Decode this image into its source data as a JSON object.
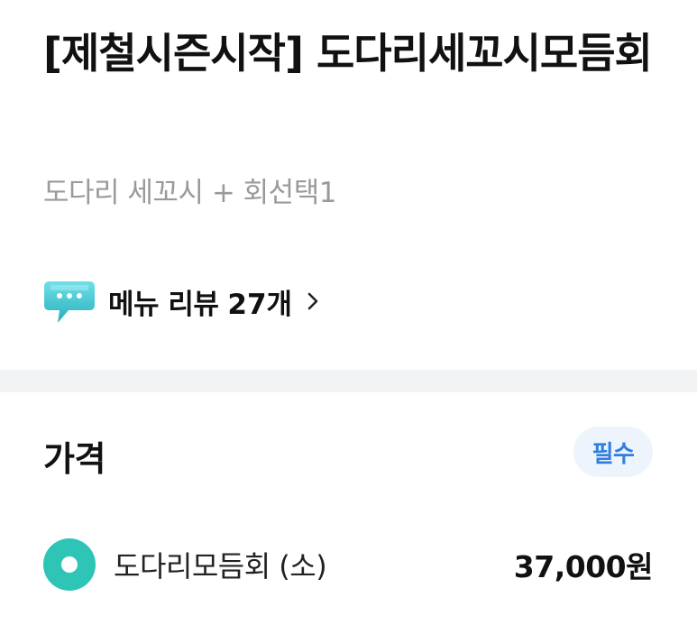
{
  "menu": {
    "title": "[제철시즌시작] 도다리세꼬시모듬회",
    "description": "도다리 세꼬시 + 회선택1"
  },
  "reviews": {
    "label": "메뉴 리뷰",
    "count": "27개",
    "icon": "speech-bubble-icon",
    "icon_color": "#3fc7d4"
  },
  "price_section": {
    "title": "가격",
    "required_badge": "필수",
    "options": [
      {
        "label": "도다리모듬회 (소)",
        "price": "37,000원",
        "selected": true
      }
    ]
  },
  "colors": {
    "accent": "#2ec4b6",
    "badge_text": "#2f7fe0",
    "badge_bg": "#edf4fc",
    "divider": "#f2f3f5"
  }
}
